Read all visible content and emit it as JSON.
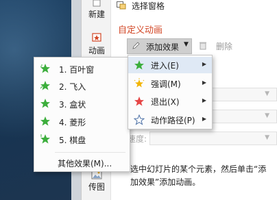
{
  "side_rail": {
    "new_label": "新建",
    "animation_label": "动画",
    "image_label": "传图"
  },
  "pane": {
    "select_pane_label": "选择窗格",
    "custom_animation_title": "自定义动画",
    "add_effect_label": "添加效果",
    "delete_label": "删除",
    "speed_label": "速度:",
    "hint_text": "选中幻灯片的某个元素，然后单击“添加效果”添加动画。"
  },
  "effect_menu": {
    "items": [
      {
        "label": "进入(E)",
        "icon": "green-star-enter-icon"
      },
      {
        "label": "强调(M)",
        "icon": "yellow-star-emphasis-icon"
      },
      {
        "label": "退出(X)",
        "icon": "red-star-exit-icon"
      },
      {
        "label": "动作路径(P)",
        "icon": "outline-star-path-icon"
      }
    ]
  },
  "enter_submenu": {
    "items": [
      {
        "label": "1. 百叶窗"
      },
      {
        "label": "2. 飞入"
      },
      {
        "label": "3. 盒状"
      },
      {
        "label": "4. 菱形"
      },
      {
        "label": "5. 棋盘"
      }
    ],
    "more_label": "其他效果(M)..."
  },
  "colors": {
    "accent_title": "#d24726",
    "enter_green": "#3cae3c",
    "emphasis_yellow": "#f2b400",
    "exit_red": "#e64646",
    "menu_highlight": "#dfe9f5"
  }
}
